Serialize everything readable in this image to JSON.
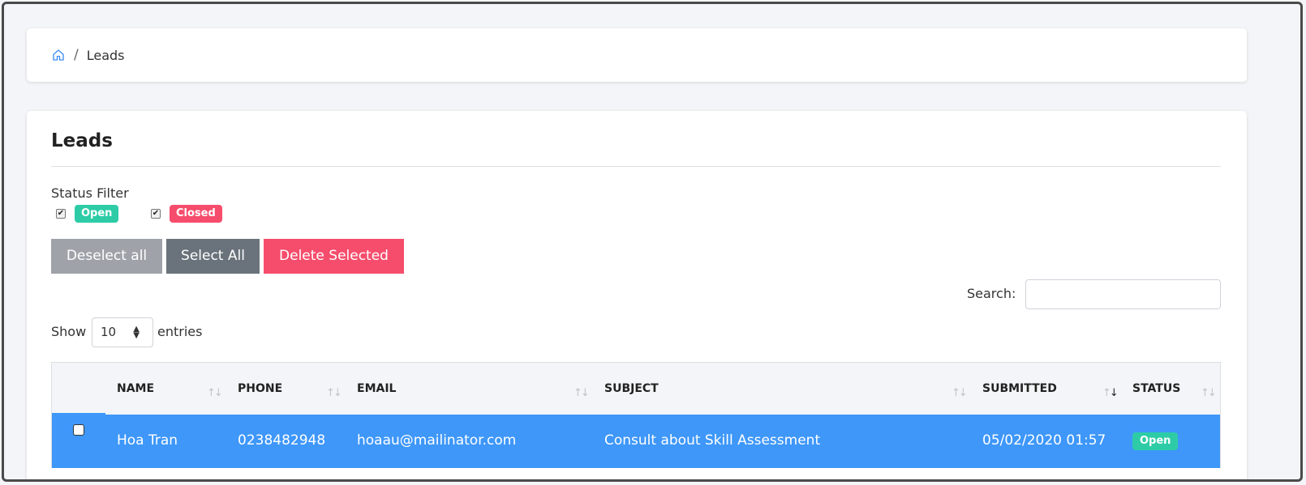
{
  "breadcrumb": {
    "home_icon": "home-icon",
    "separator": "/",
    "current": "Leads"
  },
  "page": {
    "title": "Leads"
  },
  "status_filter": {
    "label": "Status Filter",
    "options": [
      {
        "label": "Open",
        "checked": true,
        "color": "#2dcca7"
      },
      {
        "label": "Closed",
        "checked": true,
        "color": "#f64d6c"
      }
    ]
  },
  "actions": {
    "deselect_all": "Deselect all",
    "select_all": "Select All",
    "delete_selected": "Delete Selected"
  },
  "search": {
    "label": "Search:",
    "value": ""
  },
  "length": {
    "show": "Show",
    "value": "10",
    "entries": "entries"
  },
  "table": {
    "columns": [
      "NAME",
      "PHONE",
      "EMAIL",
      "SUBJECT",
      "SUBMITTED",
      "STATUS"
    ],
    "rows": [
      {
        "name": "Hoa Tran",
        "phone": "0238482948",
        "email": "hoaau@mailinator.com",
        "subject": "Consult about Skill Assessment",
        "submitted": "05/02/2020 01:57",
        "status": "Open",
        "selected": true
      }
    ]
  },
  "colors": {
    "selected_row": "#3e97f9",
    "open": "#2dcca7",
    "closed": "#f64d6c"
  }
}
